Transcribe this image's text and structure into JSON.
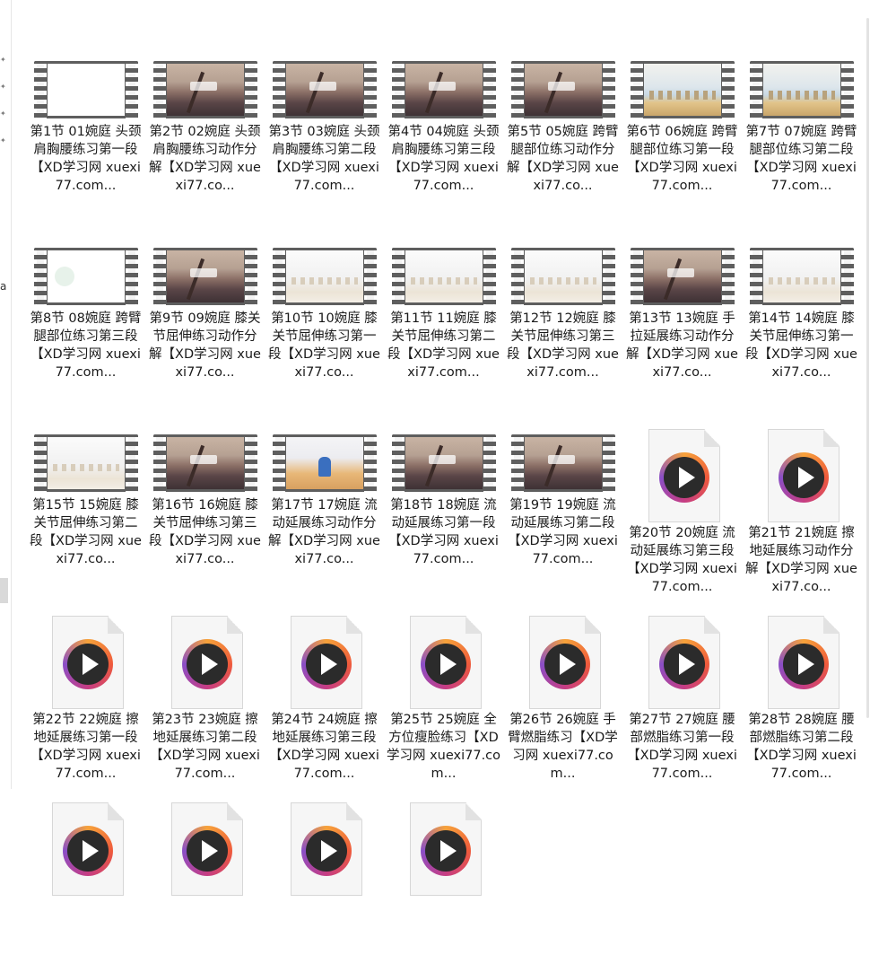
{
  "colors": {
    "accent_orange": "#f6a23a",
    "accent_purple": "#8a4fc7",
    "film": "#5e5e5e"
  },
  "left_pane": {
    "fragment_text": "a"
  },
  "items": [
    {
      "label": "第1节 01婉庭 头颈肩胸腰练习第一段【XD学习网 xuexi77.com...",
      "kind": "video",
      "thumb": "white"
    },
    {
      "label": "第2节 02婉庭 头颈肩胸腰练习动作分解【XD学习网 xuexi77.co...",
      "kind": "video",
      "thumb": "sunset"
    },
    {
      "label": "第3节 03婉庭 头颈肩胸腰练习第二段【XD学习网 xuexi77.com...",
      "kind": "video",
      "thumb": "sunset"
    },
    {
      "label": "第4节 04婉庭 头颈肩胸腰练习第三段【XD学习网 xuexi77.com...",
      "kind": "video",
      "thumb": "sunset"
    },
    {
      "label": "第5节 05婉庭 跨臂腿部位练习动作分解【XD学习网 xuexi77.co...",
      "kind": "video",
      "thumb": "sunset"
    },
    {
      "label": "第6节 06婉庭 跨臂腿部位练习第一段【XD学习网 xuexi77.com...",
      "kind": "video",
      "thumb": "studio"
    },
    {
      "label": "第7节 07婉庭 跨臂腿部位练习第二段【XD学习网 xuexi77.com...",
      "kind": "video",
      "thumb": "studio"
    },
    {
      "label": "第8节 08婉庭 跨臂腿部位练习第三段【XD学习网 xuexi77.com...",
      "kind": "video",
      "thumb": "logo"
    },
    {
      "label": "第9节 09婉庭 膝关节屈伸练习动作分解【XD学习网 xuexi77.co...",
      "kind": "video",
      "thumb": "sunset"
    },
    {
      "label": "第10节 10婉庭 膝关节屈伸练习第一段【XD学习网 xuexi77.co...",
      "kind": "video",
      "thumb": "faded"
    },
    {
      "label": "第11节 11婉庭 膝关节屈伸练习第二段【XD学习网 xuexi77.com...",
      "kind": "video",
      "thumb": "faded"
    },
    {
      "label": "第12节 12婉庭 膝关节屈伸练习第三段【XD学习网 xuexi77.com...",
      "kind": "video",
      "thumb": "faded"
    },
    {
      "label": "第13节 13婉庭 手拉延展练习动作分解【XD学习网 xuexi77.co...",
      "kind": "video",
      "thumb": "sunset"
    },
    {
      "label": "第14节 14婉庭 膝关节屈伸练习第一段【XD学习网 xuexi77.co...",
      "kind": "video",
      "thumb": "faded"
    },
    {
      "label": "第15节 15婉庭 膝关节屈伸练习第二段【XD学习网 xuexi77.co...",
      "kind": "video",
      "thumb": "faded"
    },
    {
      "label": "第16节 16婉庭 膝关节屈伸练习第三段【XD学习网 xuexi77.co...",
      "kind": "video",
      "thumb": "sunset"
    },
    {
      "label": "第17节 17婉庭 流动延展练习动作分解【XD学习网 xuexi77.co...",
      "kind": "video",
      "thumb": "yoga"
    },
    {
      "label": "第18节 18婉庭 流动延展练习第一段【XD学习网 xuexi77.com...",
      "kind": "video",
      "thumb": "sunset"
    },
    {
      "label": "第19节 19婉庭 流动延展练习第二段【XD学习网 xuexi77.com...",
      "kind": "video",
      "thumb": "sunset"
    },
    {
      "label": "第20节 20婉庭 流动延展练习第三段【XD学习网 xuexi77.com...",
      "kind": "file"
    },
    {
      "label": "第21节 21婉庭 擦地延展练习动作分解【XD学习网 xuexi77.co...",
      "kind": "file"
    },
    {
      "label": "第22节 22婉庭 擦地延展练习第一段【XD学习网 xuexi77.com...",
      "kind": "file"
    },
    {
      "label": "第23节 23婉庭 擦地延展练习第二段【XD学习网 xuexi77.com...",
      "kind": "file"
    },
    {
      "label": "第24节 24婉庭 擦地延展练习第三段【XD学习网 xuexi77.com...",
      "kind": "file"
    },
    {
      "label": "第25节 25婉庭 全方位瘦脸练习【XD学习网 xuexi77.com...",
      "kind": "file"
    },
    {
      "label": "第26节 26婉庭 手臂燃脂练习【XD学习网 xuexi77.com...",
      "kind": "file"
    },
    {
      "label": "第27节 27婉庭 腰部燃脂练习第一段【XD学习网 xuexi77.com...",
      "kind": "file"
    },
    {
      "label": "第28节 28婉庭 腰部燃脂练习第二段【XD学习网 xuexi77.com...",
      "kind": "file"
    },
    {
      "label": "",
      "kind": "file"
    },
    {
      "label": "",
      "kind": "file"
    },
    {
      "label": "",
      "kind": "file"
    },
    {
      "label": "",
      "kind": "file"
    }
  ]
}
